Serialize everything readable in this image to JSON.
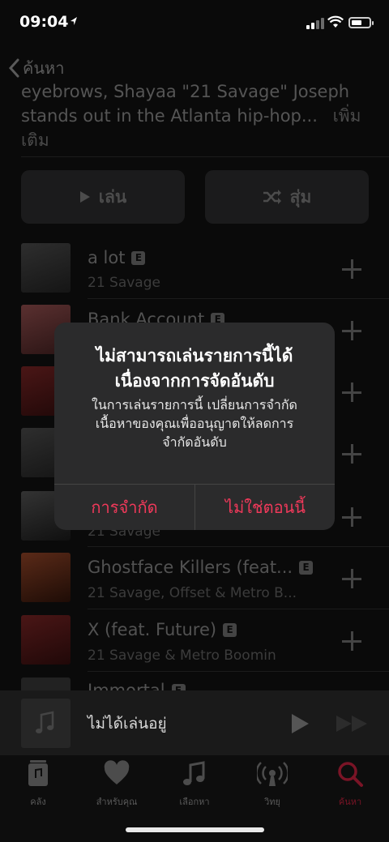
{
  "status_bar": {
    "time": "09:04"
  },
  "nav": {
    "back_label": "ค้นหา"
  },
  "description": {
    "line1": "eyebrows, Shayaa \"21 Savage\" Joseph",
    "line2": "stands out in the Atlanta hip-hop...",
    "more": "เพิ่มเติม"
  },
  "actions": {
    "play": "เล่น",
    "shuffle": "สุ่ม"
  },
  "tracks": [
    {
      "title": "a lot",
      "explicit": "E",
      "artist": "21 Savage"
    },
    {
      "title": "Bank Account",
      "explicit": "E",
      "artist": ""
    },
    {
      "title": "",
      "explicit": "",
      "artist": ""
    },
    {
      "title": "",
      "explicit": "",
      "artist": ""
    },
    {
      "title": "",
      "explicit": "",
      "artist": "21 Savage"
    },
    {
      "title": "Ghostface Killers (feat...",
      "explicit": "E",
      "artist": "21 Savage, Offset & Metro B..."
    },
    {
      "title": "X (feat. Future)",
      "explicit": "E",
      "artist": "21 Savage & Metro Boomin"
    },
    {
      "title": "Immortal",
      "explicit": "E",
      "artist": ""
    }
  ],
  "dialog": {
    "title_line1": "ไม่สามารถเล่นรายการนี้ได้",
    "title_line2": "เนื่องจากการจัดอันดับ",
    "message_line1": "ในการเล่นรายการนี้ เปลี่ยนการจำกัด",
    "message_line2": "เนื้อหาของคุณเพื่ออนุญาตให้ลดการ",
    "message_line3": "จำกัดอันดับ",
    "left_button": "การจำกัด",
    "right_button": "ไม่ใช่ตอนนี้",
    "accent_color": "#f0395a"
  },
  "mini_player": {
    "status": "ไม่ได้เล่นอยู่"
  },
  "tab_bar": {
    "items": [
      {
        "label": "คลัง",
        "icon": "library-icon"
      },
      {
        "label": "สำหรับคุณ",
        "icon": "heart-icon"
      },
      {
        "label": "เลือกหา",
        "icon": "music-note-icon"
      },
      {
        "label": "วิทยุ",
        "icon": "radio-icon"
      },
      {
        "label": "ค้นหา",
        "icon": "search-icon"
      }
    ]
  }
}
